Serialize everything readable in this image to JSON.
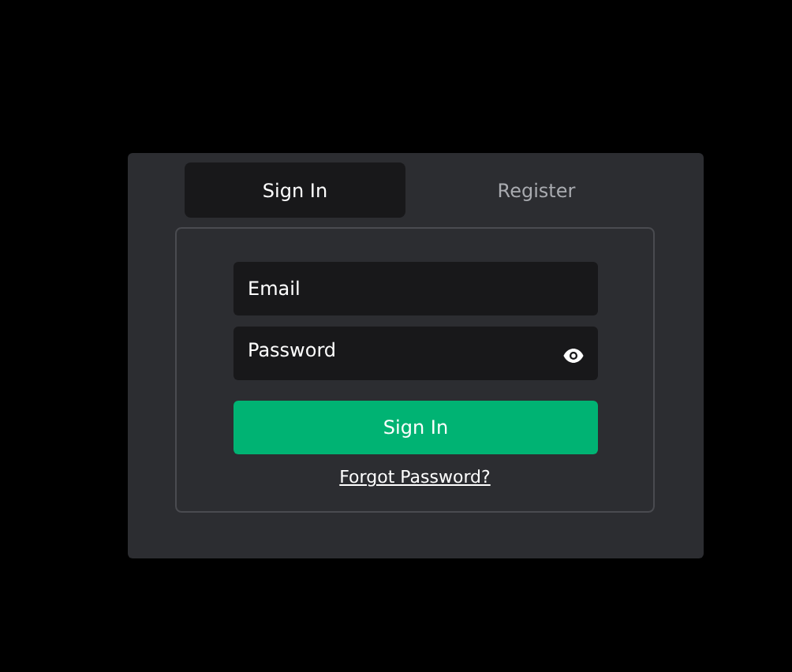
{
  "tabs": [
    {
      "label": "Sign In",
      "selected": true
    },
    {
      "label": "Register",
      "selected": false
    }
  ],
  "form": {
    "email": {
      "placeholder": "Email"
    },
    "password": {
      "placeholder": "Password",
      "masked": true
    },
    "submit": "Sign In",
    "forgot_link": "Forgot Password?"
  }
}
